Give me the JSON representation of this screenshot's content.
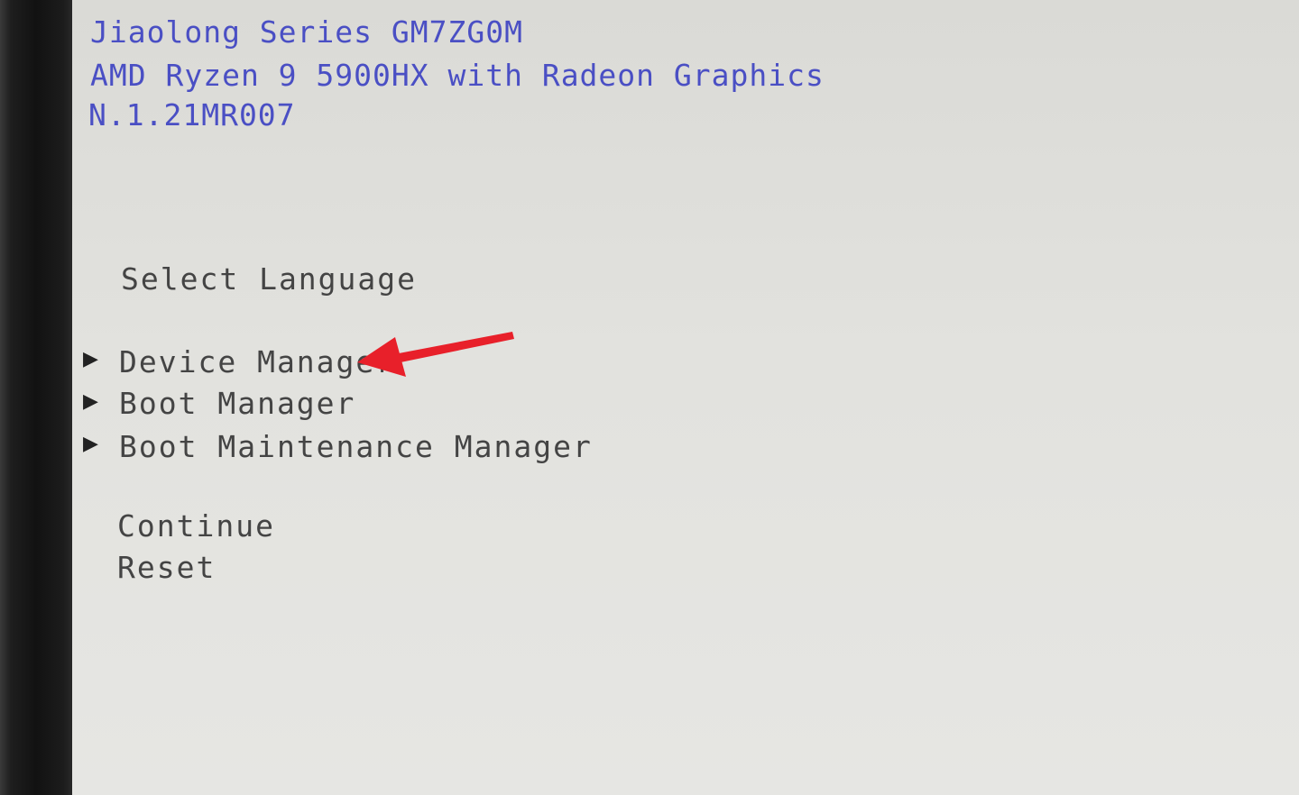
{
  "bios_header": {
    "model_line": "Jiaolong Series GM7ZG0M",
    "cpu_line": "AMD Ryzen 9 5900HX with Radeon Graphics",
    "firmware_line": "N.1.21MR007"
  },
  "menu": {
    "select_language": "Select Language",
    "submenus": [
      {
        "label": "Device Manager",
        "marker": "▶"
      },
      {
        "label": "Boot Manager",
        "marker": "▶"
      },
      {
        "label": "Boot Maintenance Manager",
        "marker": "▶"
      }
    ],
    "continue": "Continue",
    "reset": "Reset"
  },
  "colors": {
    "header_text": "#4a4fc4",
    "menu_text": "#444444",
    "screen_bg": "#e0e0dc",
    "annotation_arrow": "#e8202a"
  },
  "icons": {
    "submenu_marker": "triangle-right-icon",
    "annotation": "red-arrow-icon"
  }
}
